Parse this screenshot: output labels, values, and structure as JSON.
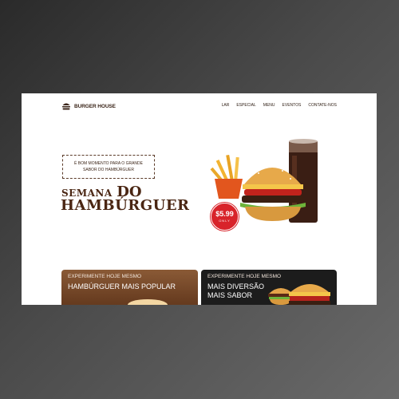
{
  "brand": {
    "name": "BURGER HOUSE",
    "logo_icon": "burger-icon"
  },
  "nav": [
    "LAR",
    "ESPECIAL",
    "MENU",
    "EVENTOS",
    "CONTATE-NOS"
  ],
  "hero": {
    "promo_line1": "É BOM MOMENTO PARA O GRANDE",
    "promo_line2": "SABOR DO HAMBÚRGUER",
    "title_small": "SEMANA",
    "title_do": "DO",
    "title_big": "HAMBÚRGUER",
    "price": "$5.99",
    "price_sub": "ONLY"
  },
  "cards": [
    {
      "kicker": "EXPERIMENTE HOJE MESMO",
      "title": "HAMBÚRGUER MAIS POPULAR"
    },
    {
      "kicker": "EXPERIMENTE HOJE MESMO",
      "title_line1": "MAIS DIVERSÃO",
      "title_line2": "MAIS SABOR"
    }
  ],
  "colors": {
    "brand_brown": "#4a2613",
    "badge_red": "#d8232a",
    "card_dark": "#1c1c1c"
  }
}
